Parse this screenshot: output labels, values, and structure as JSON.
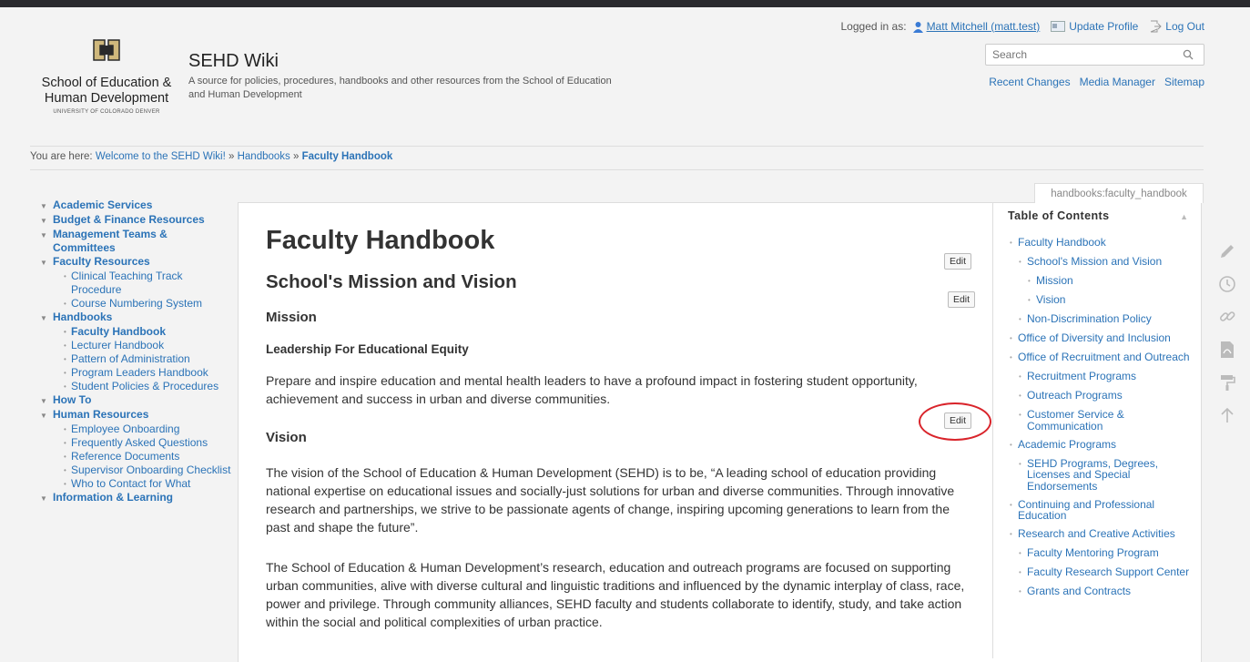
{
  "site": {
    "title": "SEHD Wiki",
    "tagline": "A source for policies, procedures, handbooks and other resources from the School of Education and Human Development",
    "logo_name": "School of Education & Human Development",
    "logo_sub": "UNIVERSITY OF COLORADO DENVER"
  },
  "user": {
    "logged_in_label": "Logged in as:",
    "name": "Matt Mitchell (matt.test)",
    "update_profile": "Update Profile",
    "logout": "Log Out"
  },
  "search": {
    "placeholder": "Search"
  },
  "tools": {
    "recent_changes": "Recent Changes",
    "media_manager": "Media Manager",
    "sitemap": "Sitemap"
  },
  "breadcrumb": {
    "prefix": "You are here:",
    "items": [
      "Welcome to the SEHD Wiki!",
      "Handbooks",
      "Faculty Handbook"
    ],
    "separator": "»"
  },
  "page_id": "handbooks:faculty_handbook",
  "sidebar": [
    {
      "label": "Academic Services",
      "children": []
    },
    {
      "label": "Budget & Finance Resources",
      "children": []
    },
    {
      "label": "Management Teams & Committees",
      "children": []
    },
    {
      "label": "Faculty Resources",
      "children": [
        "Clinical Teaching Track Procedure",
        "Course Numbering System"
      ]
    },
    {
      "label": "Handbooks",
      "children": [
        "Faculty Handbook",
        "Lecturer Handbook",
        "Pattern of Administration",
        "Program Leaders Handbook",
        "Student Policies & Procedures"
      ]
    },
    {
      "label": "How To",
      "children": []
    },
    {
      "label": "Human Resources",
      "children": [
        "Employee Onboarding",
        "Frequently Asked Questions",
        "Reference Documents",
        "Supervisor Onboarding Checklist",
        "Who to Contact for What"
      ]
    },
    {
      "label": "Information & Learning",
      "children": []
    }
  ],
  "content": {
    "h1": "Faculty Handbook",
    "h2": "School's Mission and Vision",
    "mission_heading": "Mission",
    "mission_sub": "Leadership For Educational Equity",
    "mission_text": "Prepare and inspire education and mental health leaders to have a profound impact in fostering student opportunity, achievement and success in urban and diverse communities.",
    "vision_heading": "Vision",
    "vision_text_1": "The vision of the School of Education & Human Development (SEHD) is to be, “A leading school of education providing national expertise on educational issues and socially-just solutions for urban and diverse communities. Through innovative research and partnerships, we strive to be passionate agents of change, inspiring upcoming generations to learn from the past and shape the future”.",
    "vision_text_2": "The School of Education & Human Development’s research, education and outreach programs are focused on supporting urban communities, alive with diverse cultural and linguistic traditions and influenced by the dynamic interplay of class, race, power and privilege. Through community alliances, SEHD faculty and students collaborate to identify, study, and take action within the social and political complexities of urban practice.",
    "edit_label": "Edit"
  },
  "toc": {
    "title": "Table of Contents",
    "items": [
      {
        "label": "Faculty Handbook",
        "level": 1
      },
      {
        "label": "School's Mission and Vision",
        "level": 2
      },
      {
        "label": "Mission",
        "level": 3
      },
      {
        "label": "Vision",
        "level": 3
      },
      {
        "label": "Non-Discrimination Policy",
        "level": 2
      },
      {
        "label": "Office of Diversity and Inclusion",
        "level": 1
      },
      {
        "label": "Office of Recruitment and Outreach",
        "level": 1
      },
      {
        "label": "Recruitment Programs",
        "level": 2
      },
      {
        "label": "Outreach Programs",
        "level": 2
      },
      {
        "label": "Customer Service & Communication",
        "level": 2
      },
      {
        "label": "Academic Programs",
        "level": 1
      },
      {
        "label": "SEHD Programs, Degrees, Licenses and Special Endorsements",
        "level": 2
      },
      {
        "label": "Continuing and Professional Education",
        "level": 1
      },
      {
        "label": "Research and Creative Activities",
        "level": 1
      },
      {
        "label": "Faculty Mentoring Program",
        "level": 2
      },
      {
        "label": "Faculty Research Support Center",
        "level": 2
      },
      {
        "label": "Grants and Contracts",
        "level": 2
      }
    ]
  },
  "page_tools": [
    "pencil-icon",
    "history-icon",
    "link-icon",
    "pdf-icon",
    "paint-roller-icon",
    "arrow-up-icon"
  ],
  "colors": {
    "link": "#2b73b7",
    "annotation": "#d9242b",
    "topbar": "#2a2a2e"
  }
}
